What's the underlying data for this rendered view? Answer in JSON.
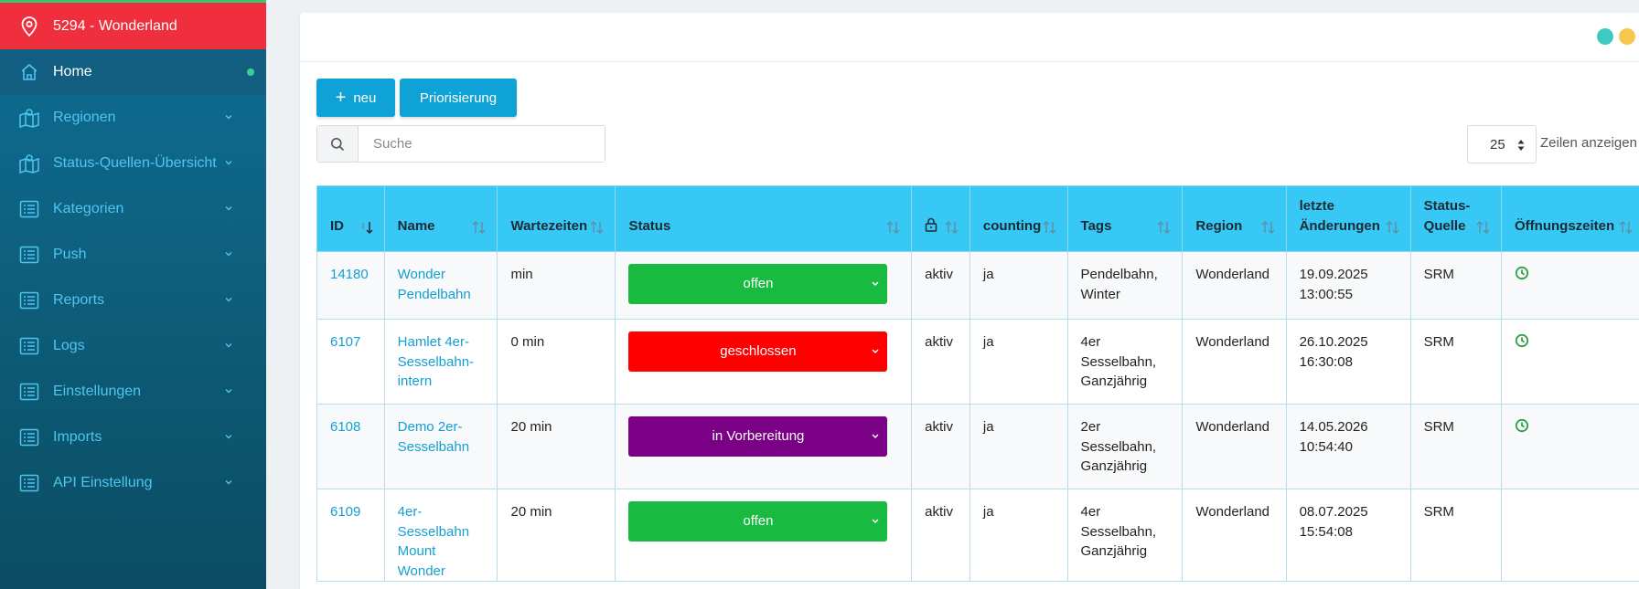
{
  "sidebar": {
    "site_title": "5294 - Wonderland",
    "items": [
      {
        "label": "Home",
        "icon": "home-icon",
        "active": true
      },
      {
        "label": "Regionen",
        "icon": "map-icon"
      },
      {
        "label": "Status-Quellen-Übersicht",
        "icon": "map-icon"
      },
      {
        "label": "Kategorien",
        "icon": "list-icon"
      },
      {
        "label": "Push",
        "icon": "list-icon"
      },
      {
        "label": "Reports",
        "icon": "list-icon"
      },
      {
        "label": "Logs",
        "icon": "list-icon"
      },
      {
        "label": "Einstellungen",
        "icon": "list-icon"
      },
      {
        "label": "Imports",
        "icon": "list-icon"
      },
      {
        "label": "API Einstellung",
        "icon": "list-icon"
      }
    ]
  },
  "toolbar": {
    "new_label": "neu",
    "prio_label": "Priorisierung"
  },
  "search": {
    "placeholder": "Suche"
  },
  "paging": {
    "rows_value": "25",
    "rows_label": "Zeilen anzeigen"
  },
  "table": {
    "headers": [
      "ID",
      "Name",
      "Wartezeiten",
      "Status",
      "",
      "counting",
      "Tags",
      "Region",
      "letzte Änderungen",
      "Status-Quelle",
      "Öffnungszeiten"
    ],
    "rows": [
      {
        "id": "14180",
        "name": "Wonder Pendelbahn",
        "wait": "min",
        "status": "offen",
        "status_color": "#18bb3f",
        "lock": "aktiv",
        "counting": "ja",
        "tags": "Pendelbahn, Winter",
        "region": "Wonderland",
        "changed": "19.09.2025 13:00:55",
        "source": "SRM",
        "hours_icon": true
      },
      {
        "id": "6107",
        "name": "Hamlet 4er-Sesselbahn-intern",
        "wait": "0 min",
        "status": "geschlossen",
        "status_color": "#fe0000",
        "lock": "aktiv",
        "counting": "ja",
        "tags": "4er Sesselbahn, Ganzjährig",
        "region": "Wonderland",
        "changed": "26.10.2025 16:30:08",
        "source": "SRM",
        "hours_icon": true
      },
      {
        "id": "6108",
        "name": "Demo 2er-Sesselbahn",
        "wait": "20 min",
        "status": "in Vorbereitung",
        "status_color": "#7a0085",
        "lock": "aktiv",
        "counting": "ja",
        "tags": "2er Sesselbahn, Ganzjährig",
        "region": "Wonderland",
        "changed": "14.05.2026 10:54:40",
        "source": "SRM",
        "hours_icon": true
      },
      {
        "id": "6109",
        "name": "4er-Sesselbahn Mount Wonder",
        "wait": "20 min",
        "status": "offen",
        "status_color": "#18bb3f",
        "lock": "aktiv",
        "counting": "ja",
        "tags": "4er Sesselbahn, Ganzjährig",
        "region": "Wonderland",
        "changed": "08.07.2025 15:54:08",
        "source": "SRM",
        "hours_icon": false
      }
    ]
  },
  "colors": {
    "accent": "#0ea2d6",
    "header": "#38c8f5",
    "site_bar": "#ef2e3e",
    "link": "#139fd2"
  }
}
